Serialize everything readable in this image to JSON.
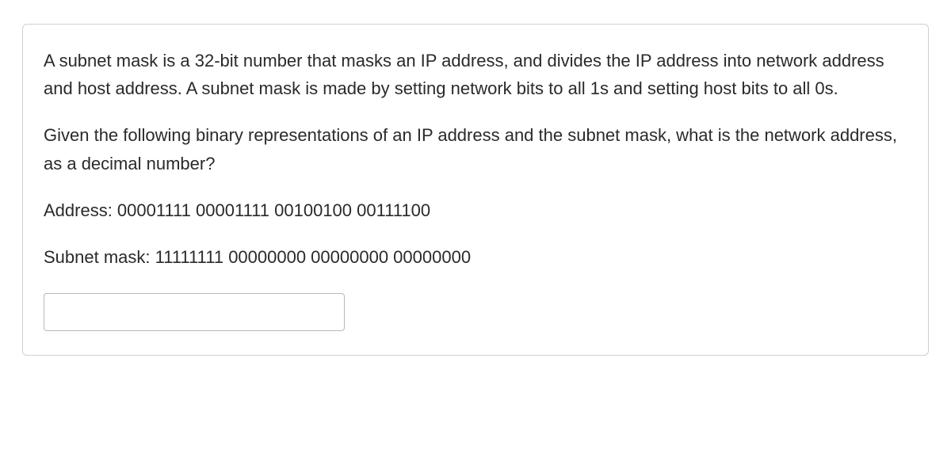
{
  "question": {
    "intro": "A subnet mask is a 32-bit number that masks an IP address, and divides the IP address into network address and host address. A subnet mask is made by setting network bits to all 1s and setting host bits to all 0s.",
    "prompt": "Given the following binary representations of an IP address and the subnet mask, what is the network address, as a decimal number?",
    "address": "Address: 00001111 00001111 00100100 00111100",
    "subnet": "Subnet mask: 11111111 00000000 00000000 00000000"
  },
  "answer": {
    "value": "",
    "placeholder": ""
  }
}
